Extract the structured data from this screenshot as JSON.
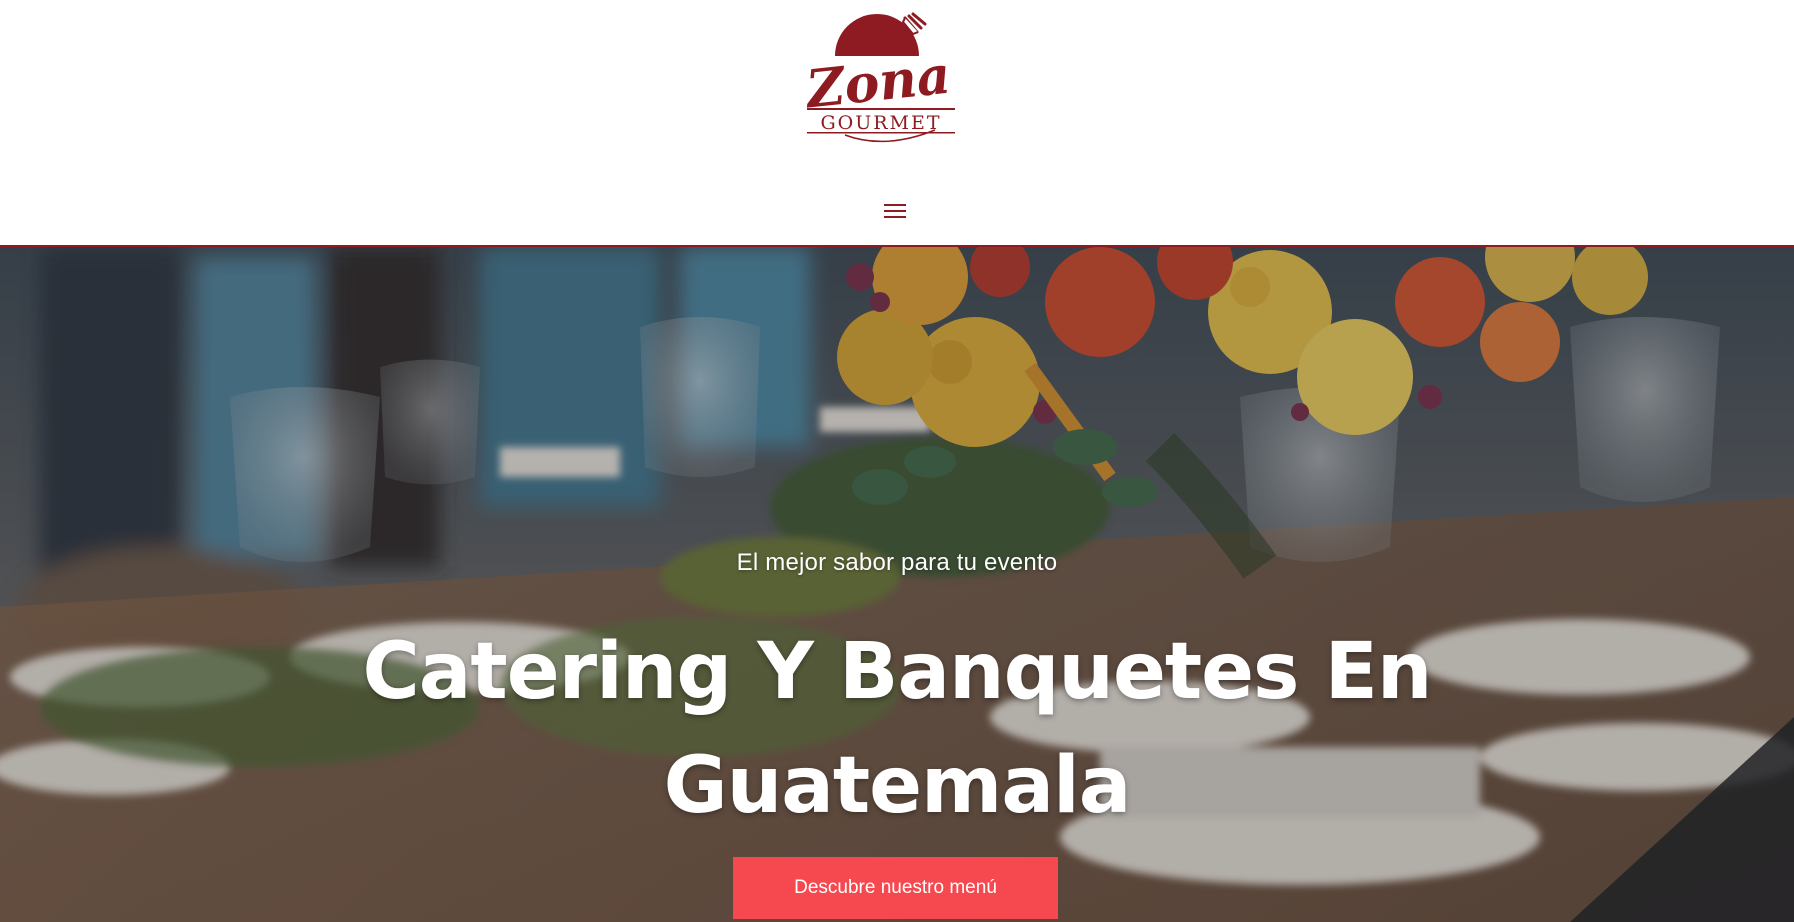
{
  "header": {
    "logo": {
      "word": "Zona",
      "subword": "GOURMET",
      "brand_color": "#8e1b22"
    },
    "menu_icon": "hamburger-menu-icon"
  },
  "hero": {
    "subtitle": "El mejor sabor para tu evento",
    "title": "Catering Y Banquetes En Guatemala",
    "cta_label": "Descubre nuestro menú",
    "cta_color": "#f5484f",
    "background_image": "banquet-table-with-flowers-and-glasses"
  }
}
